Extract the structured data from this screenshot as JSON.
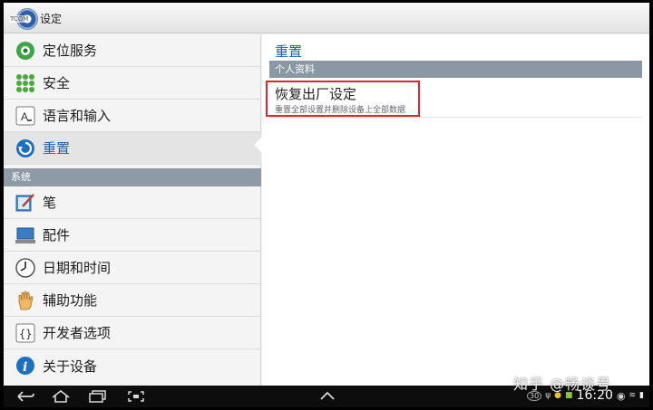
{
  "actionbar": {
    "title": "设定",
    "brand_tag": "TCOM"
  },
  "left_pane": {
    "items_top": [
      {
        "label": "定位服务",
        "icon": "location-icon"
      },
      {
        "label": "安全",
        "icon": "security-grid-icon"
      },
      {
        "label": "语言和输入",
        "icon": "language-keyboard-icon"
      },
      {
        "label": "重置",
        "icon": "reset-icon"
      }
    ],
    "section_label": "系统",
    "items_system": [
      {
        "label": "笔",
        "icon": "pen-icon"
      },
      {
        "label": "配件",
        "icon": "accessory-icon"
      },
      {
        "label": "日期和时间",
        "icon": "clock-icon"
      },
      {
        "label": "辅助功能",
        "icon": "hand-icon"
      },
      {
        "label": "开发者选项",
        "icon": "braces-icon"
      },
      {
        "label": "关于设备",
        "icon": "info-icon"
      }
    ],
    "selected": "重置"
  },
  "right_pane": {
    "title": "重置",
    "section_label": "个人资料",
    "item": {
      "title": "恢复出厂设定",
      "subtitle": "重置全部设置并删除设备上全部数据"
    }
  },
  "navbar": {
    "time": "16:20",
    "badge": "30",
    "watermark": "知乎 @畅谈号"
  },
  "colors": {
    "accent": "#1f5fa6",
    "section_bg": "#8e9aa6",
    "highlight": "#e0262a"
  }
}
